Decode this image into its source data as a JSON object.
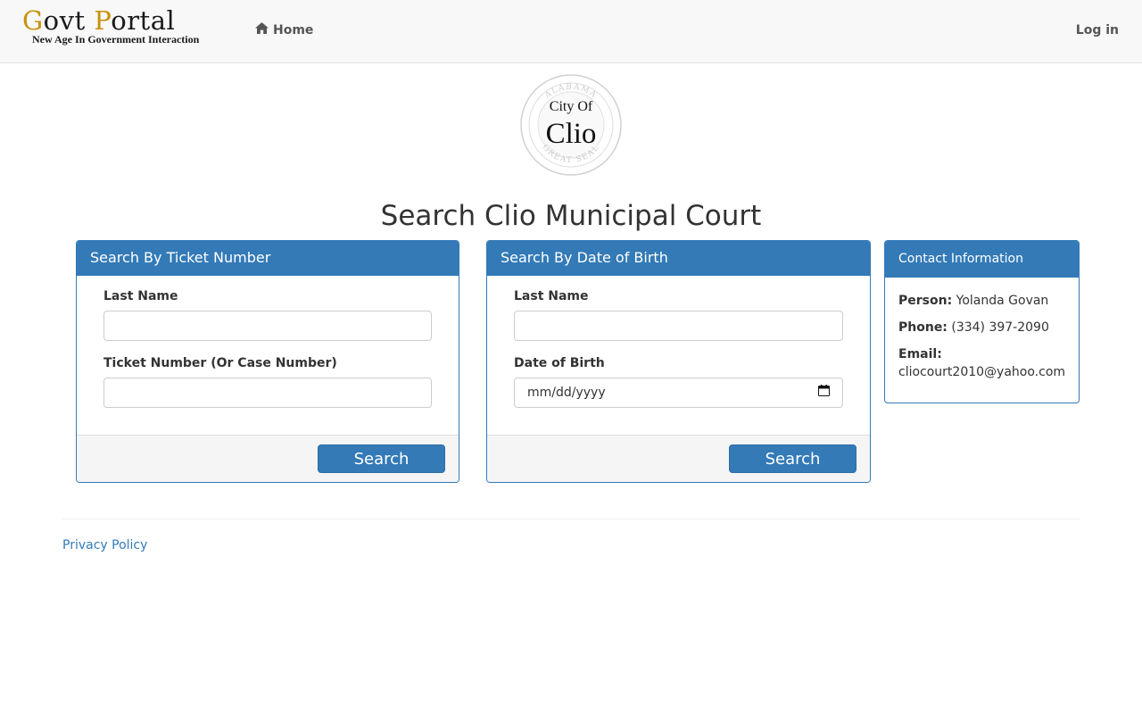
{
  "navbar": {
    "brand_title_g": "G",
    "brand_title_ovt": "ovt ",
    "brand_title_p": "P",
    "brand_title_ortal": "ortal",
    "brand_tagline": "New Age In Government Interaction",
    "home_label": "Home",
    "login_label": "Log in"
  },
  "seal": {
    "top_text": "ALABAMA",
    "bottom_text": "GREAT SEAL",
    "city_of": "City Of",
    "city_name": "Clio"
  },
  "page": {
    "title": "Search Clio Municipal Court"
  },
  "ticket_search": {
    "heading": "Search By Ticket Number",
    "last_name_label": "Last Name",
    "last_name_value": "",
    "ticket_label": "Ticket Number (Or Case Number)",
    "ticket_value": "",
    "button_label": "Search"
  },
  "dob_search": {
    "heading": "Search By Date of Birth",
    "last_name_label": "Last Name",
    "last_name_value": "",
    "dob_label": "Date of Birth",
    "dob_placeholder": "mm/dd/yyyy",
    "button_label": "Search"
  },
  "contact": {
    "heading": "Contact Information",
    "person_label": "Person:",
    "person_value": "Yolanda Govan",
    "phone_label": "Phone:",
    "phone_value": "(334) 397-2090",
    "email_label": "Email:",
    "email_value": "cliocourt2010@yahoo.com"
  },
  "footer": {
    "privacy_label": "Privacy Policy"
  },
  "colors": {
    "primary": "#337ab7",
    "brand_gold": "#c9920a",
    "navbar_bg": "#f8f8f8"
  },
  "icons": {
    "home": "home-icon",
    "calendar": "calendar-icon"
  }
}
